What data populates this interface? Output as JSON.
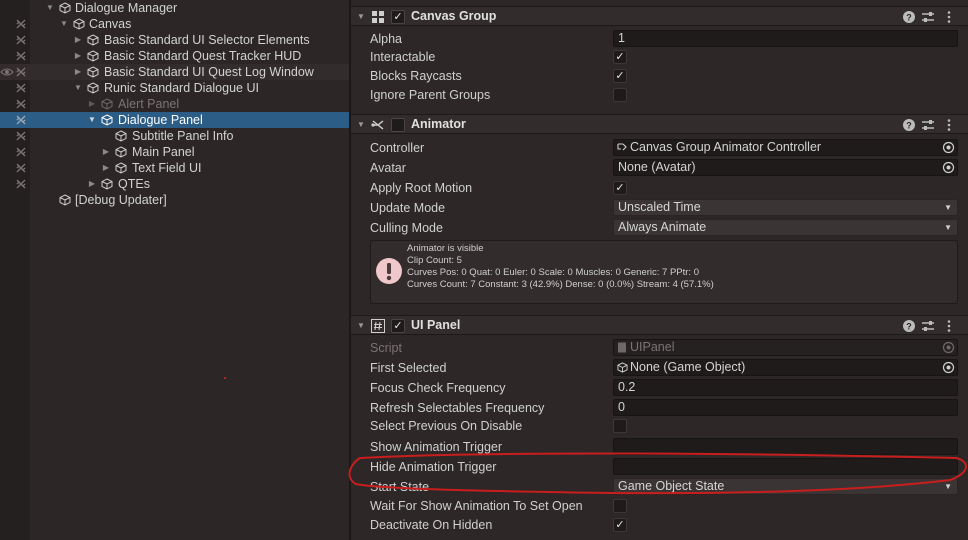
{
  "hierarchy": {
    "items": [
      {
        "label": "Dialogue Manager"
      },
      {
        "label": "Canvas"
      },
      {
        "label": "Basic Standard UI Selector Elements"
      },
      {
        "label": "Basic Standard Quest Tracker HUD"
      },
      {
        "label": "Basic Standard UI Quest Log Window"
      },
      {
        "label": "Runic Standard Dialogue UI"
      },
      {
        "label": "Alert Panel"
      },
      {
        "label": "Dialogue Panel"
      },
      {
        "label": "Subtitle Panel Info"
      },
      {
        "label": "Main Panel"
      },
      {
        "label": "Text Field UI"
      },
      {
        "label": "QTEs"
      },
      {
        "label": "[Debug Updater]"
      }
    ]
  },
  "canvas_group": {
    "title": "Canvas Group",
    "alpha_label": "Alpha",
    "alpha_value": "1",
    "interactable_label": "Interactable",
    "blocks_raycasts_label": "Blocks Raycasts",
    "ignore_parent_label": "Ignore Parent Groups"
  },
  "animator": {
    "title": "Animator",
    "controller_label": "Controller",
    "controller_value": "Canvas Group Animator Controller",
    "avatar_label": "Avatar",
    "avatar_value": "None (Avatar)",
    "apply_root_label": "Apply Root Motion",
    "update_mode_label": "Update Mode",
    "update_mode_value": "Unscaled Time",
    "culling_mode_label": "Culling Mode",
    "culling_mode_value": "Always Animate",
    "info": {
      "line1": "Animator is visible",
      "line2": "Clip Count: 5",
      "line3": "Curves Pos: 0 Quat: 0 Euler: 0 Scale: 0 Muscles: 0 Generic: 7 PPtr: 0",
      "line4": "Curves Count: 7 Constant: 3 (42.9%) Dense: 0 (0.0%) Stream: 4 (57.1%)"
    }
  },
  "ui_panel": {
    "title": "UI Panel",
    "script_label": "Script",
    "script_value": "UIPanel",
    "first_selected_label": "First Selected",
    "first_selected_value": "None (Game Object)",
    "focus_check_label": "Focus Check Frequency",
    "focus_check_value": "0.2",
    "refresh_label": "Refresh Selectables Frequency",
    "refresh_value": "0",
    "select_prev_label": "Select Previous On Disable",
    "show_trigger_label": "Show Animation Trigger",
    "show_trigger_value": "",
    "hide_trigger_label": "Hide Animation Trigger",
    "hide_trigger_value": "",
    "start_state_label": "Start State",
    "start_state_value": "Game Object State",
    "wait_label": "Wait For Show Animation To Set Open",
    "deactivate_label": "Deactivate On Hidden"
  },
  "glyphs": {
    "check": "✓",
    "fold_open": "▼",
    "fold_closed": "▶",
    "dropdown": "▼",
    "help": "?",
    "menu": "⋮"
  },
  "colors": {
    "selection": "#2c5d87",
    "annotation_red": "#c81e1e",
    "panel_bg": "#2d2727"
  }
}
